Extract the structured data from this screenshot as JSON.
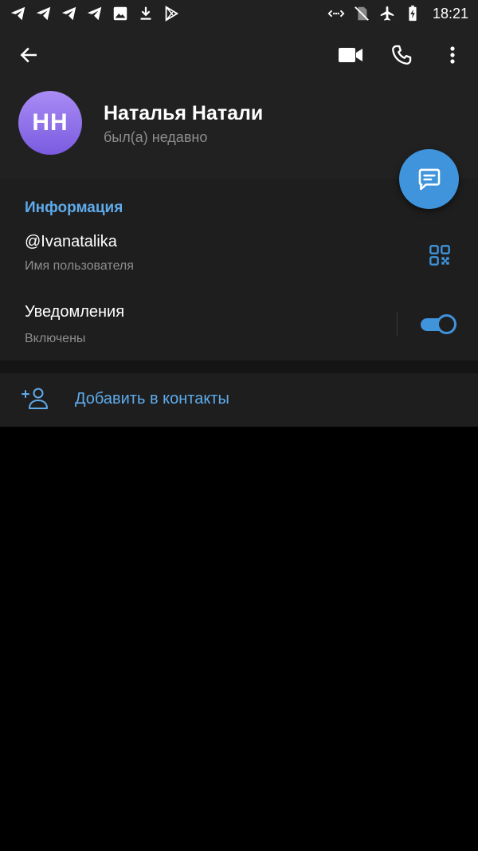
{
  "status_bar": {
    "time": "18:21",
    "left_icons": [
      "telegram-icon",
      "telegram-icon",
      "telegram-icon",
      "telegram-icon",
      "image-icon",
      "download-icon",
      "play-store-icon"
    ],
    "right_icons": [
      "data-saver-icon",
      "no-sim-icon",
      "airplane-icon",
      "battery-charging-icon"
    ]
  },
  "header": {
    "avatar_initials": "НН",
    "name": "Наталья Натали",
    "status": "был(а) недавно",
    "icons": [
      "back-arrow-icon",
      "video-camera-icon",
      "phone-icon",
      "more-vertical-icon"
    ]
  },
  "info": {
    "section_title": "Информация",
    "username": "@Ivanatalika",
    "username_label": "Имя пользователя",
    "notifications_title": "Уведомления",
    "notifications_state": "Включены",
    "notifications_enabled": true
  },
  "actions": {
    "add_contact": "Добавить в контакты"
  },
  "colors": {
    "accent": "#3f94dc",
    "accent_text": "#5fabeb",
    "background": "#000000",
    "surface": "#1e1e1e",
    "header_bg": "#212121",
    "secondary_text": "#8d8d8d"
  }
}
